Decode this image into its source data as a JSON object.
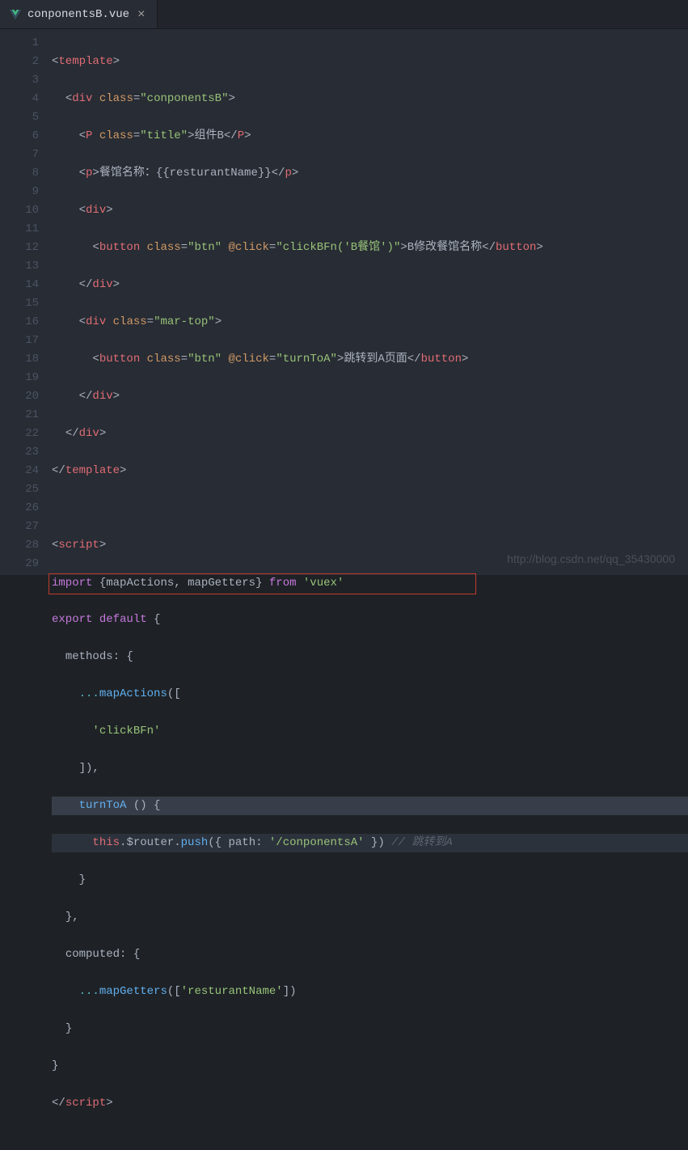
{
  "tab": {
    "filename": "conponentsB.vue",
    "icon": "vue-logo-icon",
    "close": "×"
  },
  "lineNumbers": [
    "1",
    "2",
    "3",
    "4",
    "5",
    "6",
    "7",
    "8",
    "9",
    "10",
    "11",
    "12",
    "13",
    "14",
    "15",
    "16",
    "17",
    "18",
    "19",
    "20",
    "21",
    "22",
    "23",
    "24",
    "25",
    "26",
    "27",
    "28",
    "29"
  ],
  "code": {
    "l1": {
      "template": "template"
    },
    "l2": {
      "div": "div",
      "classAttr": "class",
      "classVal": "\"conponentsB\""
    },
    "l3": {
      "p": "P",
      "classAttr": "class",
      "classVal": "\"title\"",
      "text": "组件B"
    },
    "l4": {
      "p": "p",
      "text1": "餐馆名称：{{resturantName}}"
    },
    "l5": {
      "div": "div"
    },
    "l6": {
      "button": "button",
      "classAttr": "class",
      "classVal": "\"btn\"",
      "clickAttr": "@click",
      "clickVal": "\"clickBFn('B餐馆')\"",
      "text": "B修改餐馆名称"
    },
    "l7": {
      "div": "div"
    },
    "l8": {
      "div": "div",
      "classAttr": "class",
      "classVal": "\"mar-top\""
    },
    "l9": {
      "button": "button",
      "classAttr": "class",
      "classVal": "\"btn\"",
      "clickAttr": "@click",
      "clickVal": "\"turnToA\"",
      "text": "跳转到A页面"
    },
    "l10": {
      "div": "div"
    },
    "l11": {
      "div": "div"
    },
    "l12": {
      "template": "template"
    },
    "l14": {
      "script": "script"
    },
    "l15": {
      "import": "import",
      "mapActions": "mapActions",
      "mapGetters": "mapGetters",
      "from": "from",
      "vuex": "'vuex'"
    },
    "l16": {
      "export": "export",
      "default": "default"
    },
    "l17": {
      "methods": "methods"
    },
    "l18": {
      "mapActions": "mapActions"
    },
    "l19": {
      "clickBFn": "'clickBFn'"
    },
    "l21": {
      "turnToA": "turnToA"
    },
    "l22": {
      "this": "this",
      "router": "$router",
      "push": "push",
      "path": "path",
      "pathVal": "'/conponentsA'",
      "comment": "// 跳转到A"
    },
    "l25": {
      "computed": "computed"
    },
    "l26": {
      "mapGetters": "mapGetters",
      "resturantName": "'resturantName'"
    },
    "l29": {
      "script": "script"
    }
  },
  "watermark": "http://blog.csdn.net/qq_35430000"
}
